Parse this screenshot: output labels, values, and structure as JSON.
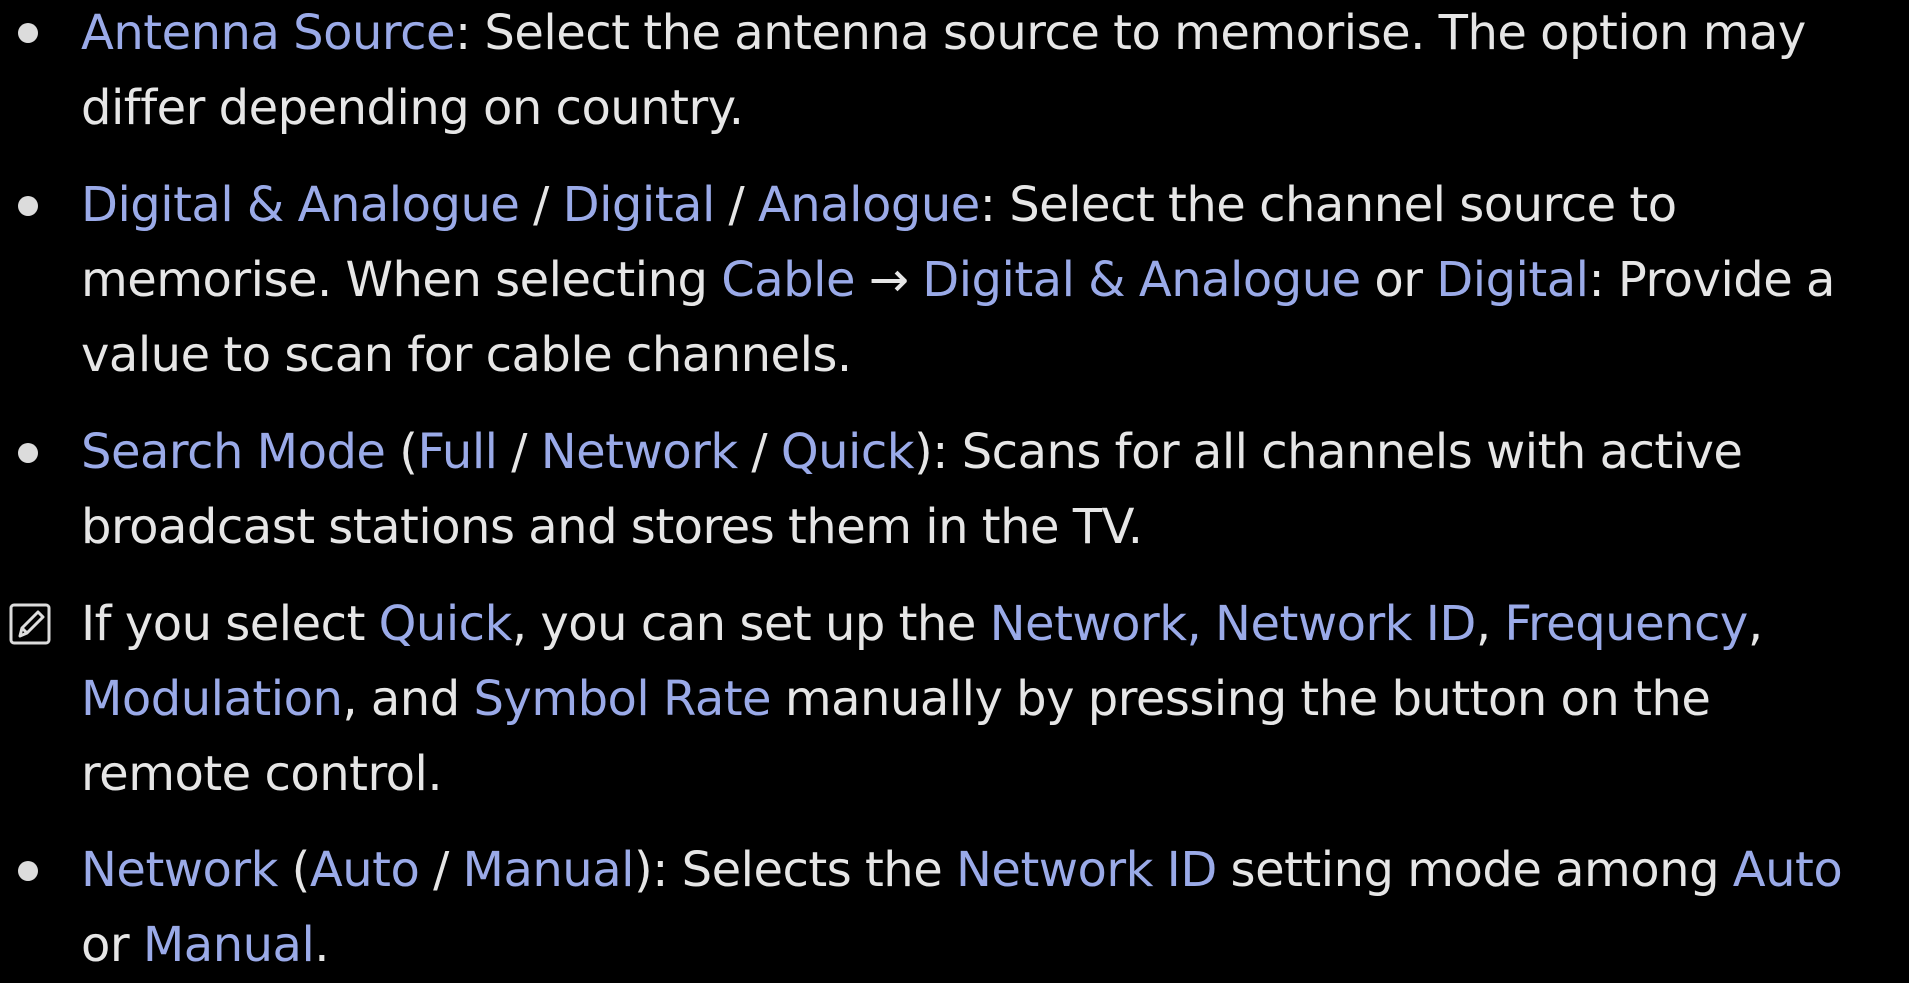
{
  "colors": {
    "background": "#000000",
    "body_text": "#e6e6e6",
    "highlight": "#9aaae8"
  },
  "items": [
    {
      "marker": "bullet",
      "segments": [
        {
          "text": "Antenna Source",
          "hl": true
        },
        {
          "text": ": Select the antenna source to memorise. The option may differ depending on country.",
          "hl": false
        }
      ]
    },
    {
      "marker": "bullet",
      "segments": [
        {
          "text": "Digital & Analogue",
          "hl": true
        },
        {
          "text": " / ",
          "hl": false
        },
        {
          "text": "Digital",
          "hl": true
        },
        {
          "text": " / ",
          "hl": false
        },
        {
          "text": "Analogue",
          "hl": true
        },
        {
          "text": ": Select the channel source to memorise. When selecting ",
          "hl": false
        },
        {
          "text": "Cable",
          "hl": true
        },
        {
          "text": " → ",
          "hl": false
        },
        {
          "text": "Digital & Analogue",
          "hl": true
        },
        {
          "text": " or ",
          "hl": false
        },
        {
          "text": "Digital",
          "hl": true
        },
        {
          "text": ": Provide a value to scan for cable channels.",
          "hl": false
        }
      ]
    },
    {
      "marker": "bullet",
      "segments": [
        {
          "text": "Search Mode",
          "hl": true
        },
        {
          "text": " (",
          "hl": false
        },
        {
          "text": "Full",
          "hl": true
        },
        {
          "text": " / ",
          "hl": false
        },
        {
          "text": "Network",
          "hl": true
        },
        {
          "text": " / ",
          "hl": false
        },
        {
          "text": "Quick",
          "hl": true
        },
        {
          "text": "): Scans for all channels with active broadcast stations and stores them in the TV.",
          "hl": false
        }
      ]
    },
    {
      "marker": "note",
      "segments": [
        {
          "text": "If you select ",
          "hl": false
        },
        {
          "text": "Quick",
          "hl": true
        },
        {
          "text": ", you can set up the ",
          "hl": false
        },
        {
          "text": "Network, Network ID",
          "hl": true
        },
        {
          "text": ", ",
          "hl": false
        },
        {
          "text": "Frequency",
          "hl": true
        },
        {
          "text": ", ",
          "hl": false
        },
        {
          "text": "Modulation",
          "hl": true
        },
        {
          "text": ", and ",
          "hl": false
        },
        {
          "text": "Symbol Rate",
          "hl": true
        },
        {
          "text": " manually by pressing the button on the remote control.",
          "hl": false
        }
      ]
    },
    {
      "marker": "bullet",
      "segments": [
        {
          "text": "Network",
          "hl": true
        },
        {
          "text": " (",
          "hl": false
        },
        {
          "text": "Auto",
          "hl": true
        },
        {
          "text": " / ",
          "hl": false
        },
        {
          "text": "Manual",
          "hl": true
        },
        {
          "text": "): Selects the ",
          "hl": false
        },
        {
          "text": "Network ID",
          "hl": true
        },
        {
          "text": " setting mode among ",
          "hl": false
        },
        {
          "text": "Auto",
          "hl": true
        },
        {
          "text": " or ",
          "hl": false
        },
        {
          "text": "Manual",
          "hl": true
        },
        {
          "text": ".",
          "hl": false
        }
      ]
    }
  ]
}
